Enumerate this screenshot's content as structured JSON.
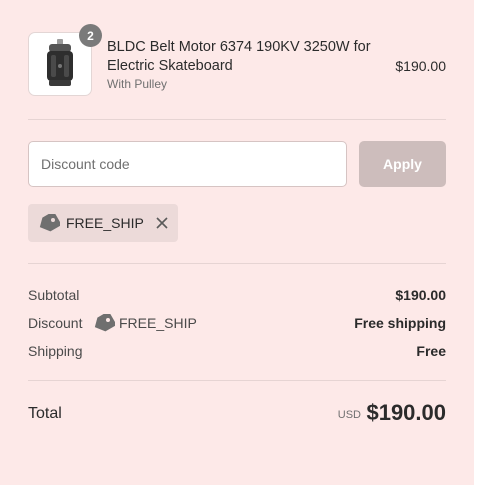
{
  "line_item": {
    "quantity": "2",
    "title": "BLDC Belt Motor 6374 190KV 3250W for Electric Skateboard",
    "variant": "With Pulley",
    "price": "$190.00"
  },
  "discount": {
    "placeholder": "Discount code",
    "apply_label": "Apply",
    "applied_code": "FREE_SHIP"
  },
  "summary": {
    "subtotal_label": "Subtotal",
    "subtotal_value": "$190.00",
    "discount_label": "Discount",
    "discount_code": "FREE_SHIP",
    "discount_value": "Free shipping",
    "shipping_label": "Shipping",
    "shipping_value": "Free"
  },
  "total": {
    "label": "Total",
    "currency": "USD",
    "amount": "$190.00"
  },
  "colors": {
    "background": "#fde9e8",
    "apply_button": "#cdbdbc",
    "chip": "#ecdad9",
    "badge": "#7a7a7a"
  }
}
